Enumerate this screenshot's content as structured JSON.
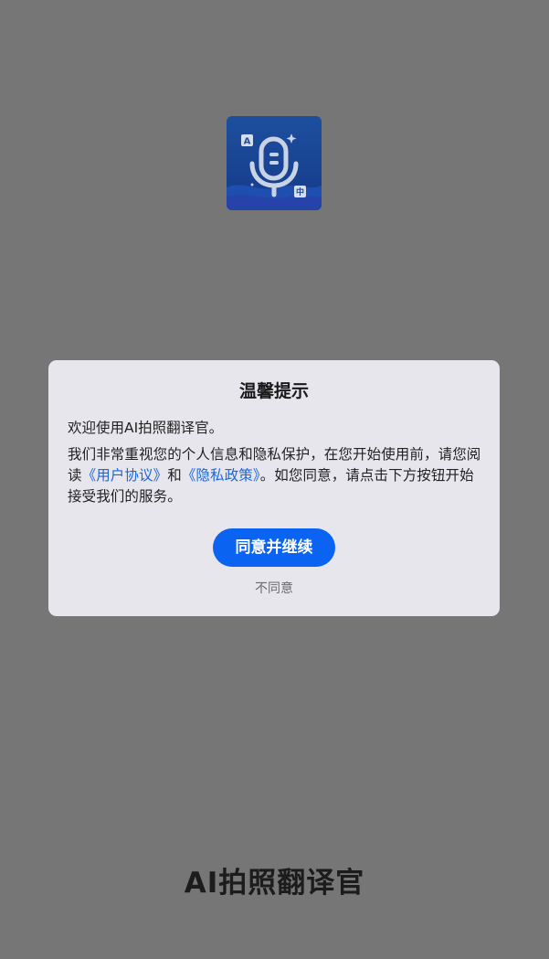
{
  "app": {
    "name": "AI拍照翻译官",
    "icon": "microphone-translate-icon",
    "icon_letters": {
      "top_left": "A",
      "bottom_right": "中"
    }
  },
  "dialog": {
    "title": "温馨提示",
    "welcome": "欢迎使用AI拍照翻译官。",
    "body_before": "我们非常重视您的个人信息和隐私保护，在您开始使用前，请您阅读",
    "user_agreement_link": "《用户协议》",
    "connector": "和",
    "privacy_policy_link": "《隐私政策》",
    "body_after": "。如您同意，请点击下方按钮开始接受我们的服务。",
    "agree_button": "同意并继续",
    "disagree_link": "不同意"
  },
  "colors": {
    "overlay": "#767676",
    "dialog_bg": "#e7e6ed",
    "primary": "#0b63f2",
    "link": "#1b66d9"
  }
}
